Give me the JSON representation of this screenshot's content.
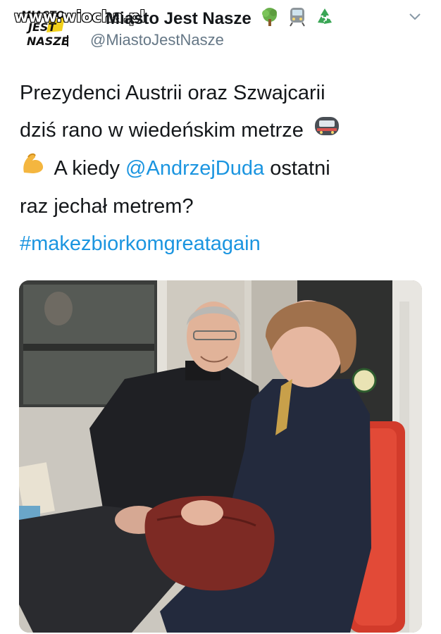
{
  "watermark": "www.wiocha.pl",
  "account": {
    "display_name": "Miasto Jest Nasze",
    "handle": "@MiastoJestNasze",
    "avatar_text": [
      "MIASTO",
      "JEST",
      "NASZE"
    ],
    "badges": [
      "tree-icon",
      "train-icon",
      "recycle-icon"
    ]
  },
  "tweet": {
    "line1": "Prezydenci Austrii oraz Szwajcarii",
    "line2": "dziś rano w wiedeńskim metrze",
    "line3_prefix": "A kiedy ",
    "mention": "@AndrzejDuda",
    "line3_suffix": " ostatni",
    "line4": "raz jechał metrem?",
    "hashtag": "#makezbiorkomgreatagain",
    "emojis": [
      "metro-icon",
      "flexed-bicep-icon"
    ]
  },
  "colors": {
    "link": "#1b95e0",
    "text": "#14171a",
    "secondary": "#657786"
  }
}
